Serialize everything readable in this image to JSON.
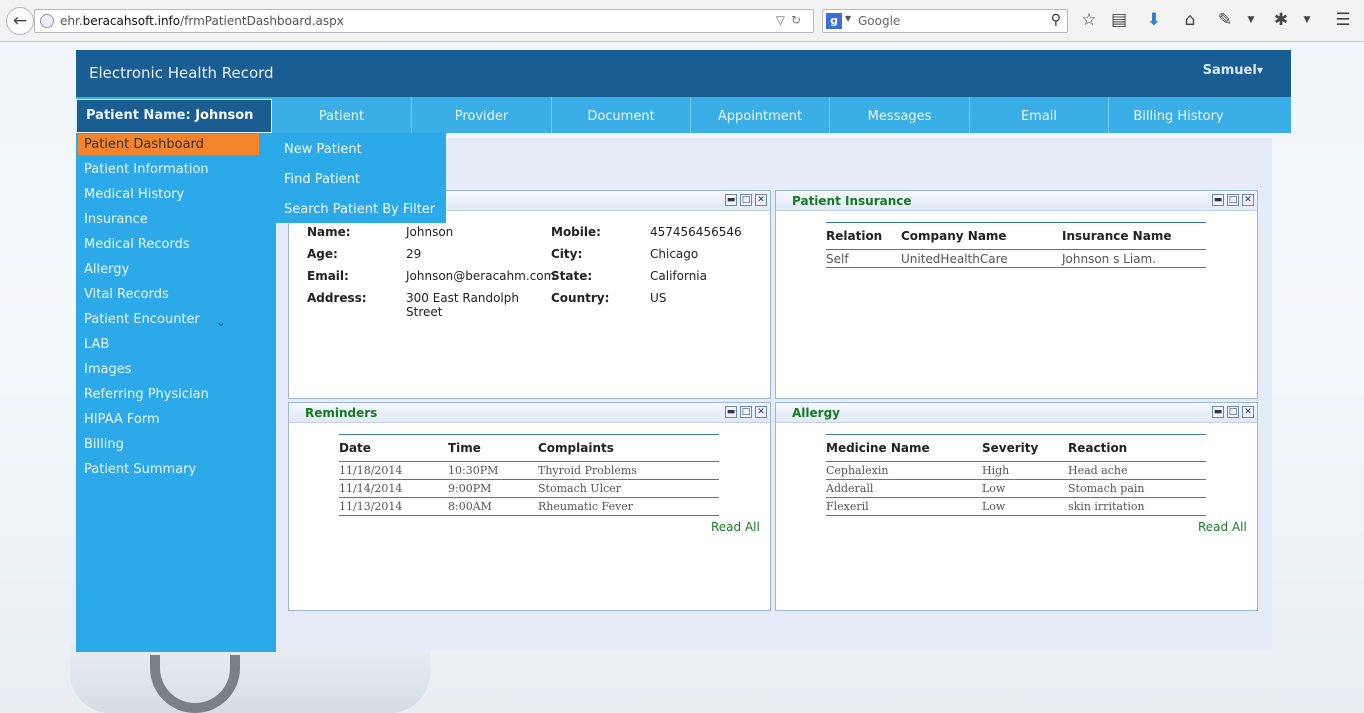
{
  "browser": {
    "url_prefix": "ehr.",
    "url_domain": "beracahsoft.info",
    "url_path": "/frmPatientDashboard.aspx",
    "search_placeholder": "Google",
    "search_engine_letter": "g"
  },
  "header": {
    "title": "Electronic Health Record",
    "user": "Samuel"
  },
  "patient_tab": {
    "label": "Patient Name:",
    "name": "Johnson"
  },
  "nav": [
    "Patient",
    "Provider",
    "Document",
    "Appointment",
    "Messages",
    "Email",
    "Billing History"
  ],
  "sidebar": [
    "Patient Dashboard",
    "Patient Information",
    "Medical History",
    "Insurance",
    "Medical Records",
    "Allergy",
    "Vital Records",
    "Patient Encounter",
    "LAB",
    "Images",
    "Referring Physician",
    "HIPAA Form",
    "Billing",
    "Patient Summary"
  ],
  "patient_menu": [
    "New Patient",
    "Find Patient",
    "Search Patient By Filter"
  ],
  "patient_info": {
    "name_label": "Name:",
    "name": "Johnson",
    "age_label": "Age:",
    "age": "29",
    "email_label": "Email:",
    "email": "Johnson@beracahm.com",
    "address_label": "Address:",
    "address_line1": "300 East Randolph",
    "address_line2": "Street",
    "mobile_label": "Mobile:",
    "mobile": "457456456546",
    "city_label": "City:",
    "city": "Chicago",
    "state_label": "State:",
    "state": "California",
    "country_label": "Country:",
    "country": "US"
  },
  "insurance": {
    "title": "Patient Insurance",
    "columns": [
      "Relation",
      "Company Name",
      "Insurance Name"
    ],
    "rows": [
      [
        "Self",
        "UnitedHealthCare",
        "Johnson s Liam."
      ]
    ]
  },
  "reminders": {
    "title": "Reminders",
    "columns": [
      "Date",
      "Time",
      "Complaints"
    ],
    "rows": [
      [
        "11/18/2014",
        "10:30PM",
        "Thyroid Problems"
      ],
      [
        "11/14/2014",
        "9:00PM",
        "Stomach Ulcer"
      ],
      [
        "11/13/2014",
        "8:00AM",
        "Rheumatic Fever"
      ]
    ],
    "read_all": "Read All"
  },
  "allergy": {
    "title": "Allergy",
    "columns": [
      "Medicine Name",
      "Severity",
      "Reaction"
    ],
    "rows": [
      [
        "Cephalexin",
        "High",
        "Head ache"
      ],
      [
        "Adderall",
        "Low",
        "Stomach pain"
      ],
      [
        "Flexeril",
        "Low",
        "skin irritation"
      ]
    ],
    "read_all": "Read All"
  },
  "icons": {
    "back": "back-arrow-icon",
    "toolbar": [
      "bookmark-star-icon",
      "reading-list-icon",
      "download-icon",
      "home-icon",
      "tools-icon",
      "addon-icon",
      "menu-icon"
    ]
  },
  "colors": {
    "header": "#1a5d93",
    "nav": "#3aaee6",
    "sidebar": "#2ba9e9",
    "active_item": "#f5852c",
    "panel_title": "#157a22"
  }
}
